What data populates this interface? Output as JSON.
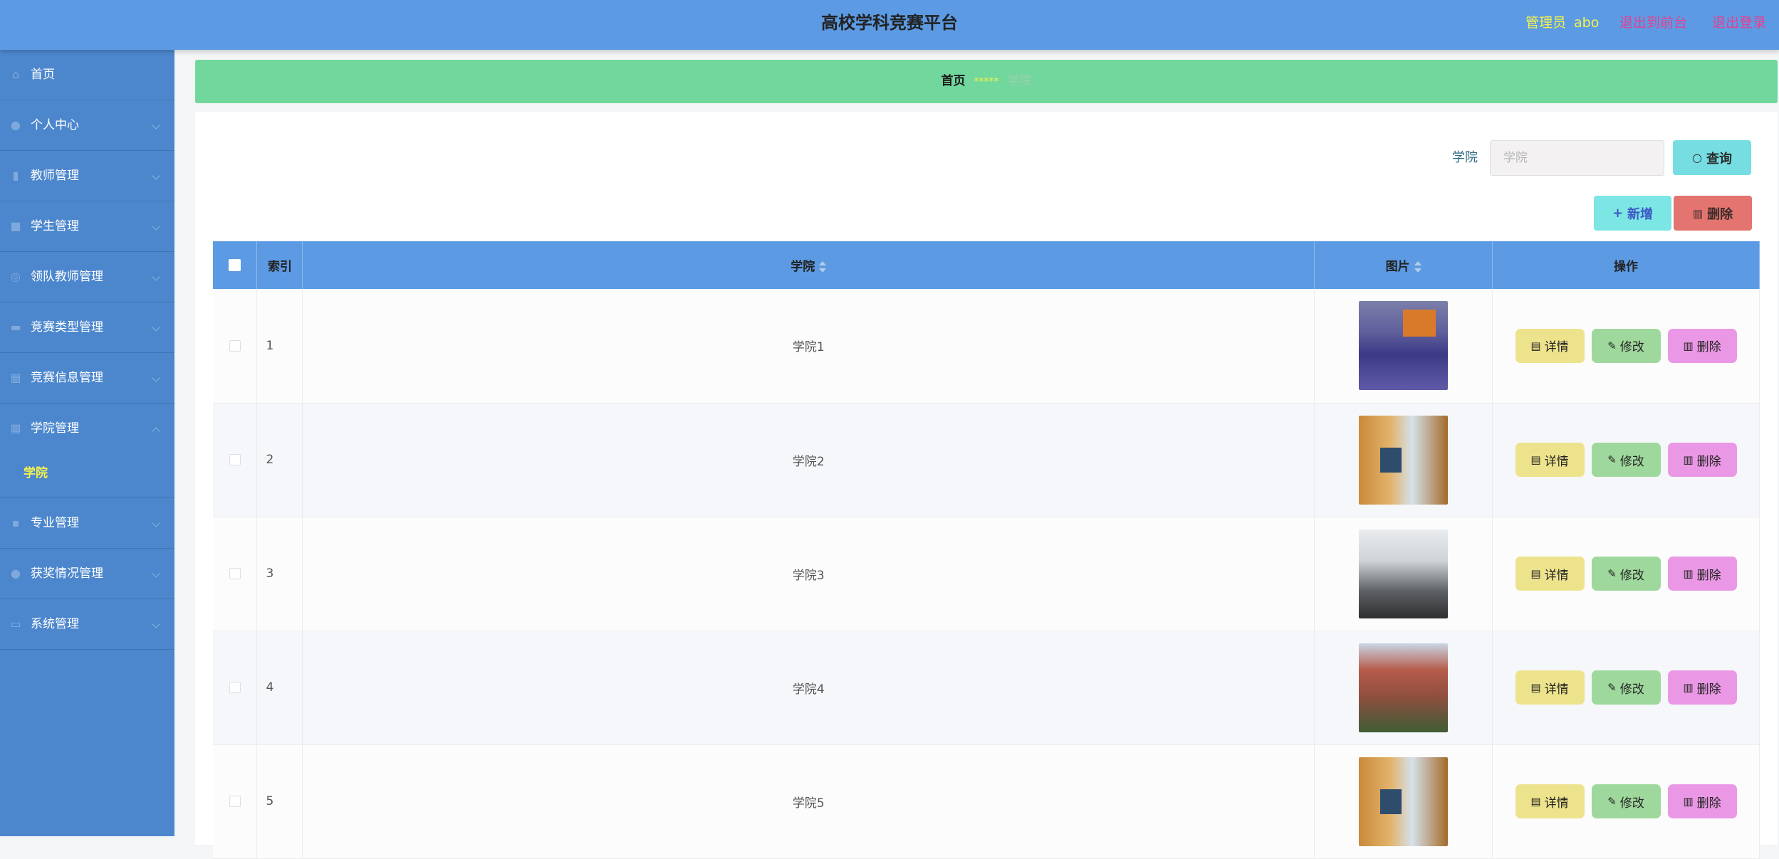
{
  "header": {
    "title": "高校学科竞赛平台",
    "role": "管理员",
    "username": "abo",
    "to_frontend": "退出到前台",
    "logout": "退出登录"
  },
  "sidebar": {
    "items": [
      {
        "label": "首页",
        "icon": "home-icon"
      },
      {
        "label": "个人中心",
        "icon": "user-icon"
      },
      {
        "label": "教师管理",
        "icon": "bar-chart-icon"
      },
      {
        "label": "学生管理",
        "icon": "truck-icon"
      },
      {
        "label": "领队教师管理",
        "icon": "compass-icon"
      },
      {
        "label": "竞赛类型管理",
        "icon": "briefcase-icon"
      },
      {
        "label": "竞赛信息管理",
        "icon": "calendar-icon"
      },
      {
        "label": "学院管理",
        "icon": "grid-icon"
      },
      {
        "label": "专业管理",
        "icon": "apps-icon"
      },
      {
        "label": "获奖情况管理",
        "icon": "location-icon"
      },
      {
        "label": "系统管理",
        "icon": "monitor-icon"
      }
    ],
    "active_sub": "学院"
  },
  "breadcrumb": {
    "home": "首页",
    "separator": "*****",
    "current": "学院"
  },
  "search": {
    "label": "学院",
    "placeholder": "学院",
    "button": "查询"
  },
  "toolbar": {
    "add": "新增",
    "delete": "删除"
  },
  "table": {
    "columns": [
      "索引",
      "学院",
      "图片",
      "操作"
    ],
    "rows": [
      {
        "index": "1",
        "name": "学院1",
        "image": "auditorium"
      },
      {
        "index": "2",
        "name": "学院2",
        "image": "dorm"
      },
      {
        "index": "3",
        "name": "学院3",
        "image": "meeting"
      },
      {
        "index": "4",
        "name": "学院4",
        "image": "campus"
      },
      {
        "index": "5",
        "name": "学院5",
        "image": "dorm"
      }
    ],
    "actions": {
      "detail": "详情",
      "edit": "修改",
      "delete": "删除"
    }
  },
  "colors": {
    "header_bg": "#5c9be3",
    "sidebar_bg": "#4c87cd",
    "breadcrumb_bg": "#72d79c",
    "accent_yellow": "#f5f24c",
    "link_pink": "#e83d8f"
  }
}
